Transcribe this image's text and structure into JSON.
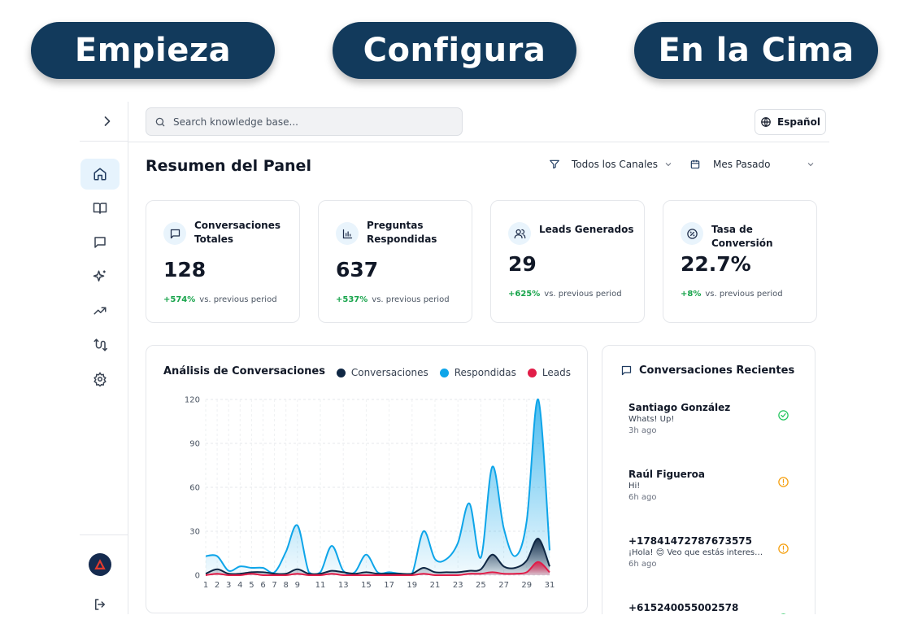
{
  "pills": [
    "Empieza",
    "Configura",
    "En la Cima"
  ],
  "search": {
    "placeholder": "Search knowledge base..."
  },
  "language": "Español",
  "page_title": "Resumen del Panel",
  "filters": {
    "channel": "Todos los Canales",
    "period": "Mes Pasado"
  },
  "nav": [
    "home-icon",
    "book-icon",
    "message-icon",
    "sparkles-icon",
    "trending-up-icon",
    "route-icon",
    "settings-icon"
  ],
  "stats": [
    {
      "label": "Conversaciones Totales",
      "value": "128",
      "delta": "+574%",
      "suffix": "vs. previous period",
      "icon": "message-icon"
    },
    {
      "label": "Preguntas Respondidas",
      "value": "637",
      "delta": "+537%",
      "suffix": "vs. previous period",
      "icon": "bar-chart-icon"
    },
    {
      "label": "Leads Generados",
      "value": "29",
      "delta": "+625%",
      "suffix": "vs. previous period",
      "icon": "users-icon"
    },
    {
      "label": "Tasa de Conversión",
      "value": "22.7%",
      "delta": "+8%",
      "suffix": "vs. previous period",
      "icon": "percent-icon"
    }
  ],
  "chart_title": "Análisis de Conversaciones",
  "chart_data": {
    "type": "area",
    "title": "Análisis de Conversaciones",
    "x": [
      1,
      2,
      3,
      4,
      5,
      6,
      7,
      8,
      9,
      10,
      11,
      12,
      13,
      14,
      15,
      16,
      17,
      18,
      19,
      20,
      21,
      22,
      23,
      24,
      25,
      26,
      27,
      28,
      29,
      30,
      31
    ],
    "xticks": [
      1,
      2,
      3,
      4,
      5,
      6,
      7,
      8,
      9,
      11,
      13,
      15,
      17,
      19,
      21,
      23,
      25,
      27,
      29,
      31
    ],
    "ylim": [
      0,
      120
    ],
    "yticks": [
      0,
      30,
      60,
      90,
      120
    ],
    "grid": true,
    "legend": "top-right",
    "series": [
      {
        "name": "Respondidas",
        "color": "#0ea5e9",
        "values": [
          13,
          13,
          3,
          6,
          5,
          5,
          2,
          16,
          34,
          2,
          2,
          20,
          3,
          2,
          14,
          2,
          2,
          1,
          1,
          30,
          11,
          11,
          22,
          49,
          12,
          74,
          32,
          13,
          37,
          120,
          17
        ]
      },
      {
        "name": "Conversaciones",
        "color": "#0f2744",
        "values": [
          1,
          4,
          1,
          1,
          2,
          2,
          1,
          1,
          4,
          1,
          1,
          3,
          2,
          1,
          2,
          1,
          1,
          1,
          1,
          5,
          2,
          2,
          2,
          3,
          4,
          14,
          6,
          5,
          10,
          25,
          6
        ]
      },
      {
        "name": "Leads",
        "color": "#e11d48",
        "values": [
          0,
          1,
          0,
          0,
          1,
          0,
          0,
          0,
          1,
          0,
          0,
          1,
          0,
          0,
          0,
          0,
          0,
          0,
          0,
          1,
          0,
          0,
          0,
          1,
          1,
          2,
          1,
          1,
          2,
          9,
          2
        ]
      }
    ]
  },
  "legend": [
    "Conversaciones",
    "Respondidas",
    "Leads"
  ],
  "recent_title": "Conversaciones Recientes",
  "recent": [
    {
      "name": "Santiago González",
      "message": "Whats! Up!",
      "time": "3h ago",
      "status": "resolved"
    },
    {
      "name": "Raúl Figueroa",
      "message": "Hi!",
      "time": "6h ago",
      "status": "pending"
    },
    {
      "name": "+17841472787673575",
      "message": "¡Hola! 😊 Veo que estás interesa...",
      "time": "6h ago",
      "status": "pending"
    },
    {
      "name": "+615240055002578",
      "message": "",
      "time": "",
      "status": "resolved"
    }
  ],
  "colors": {
    "brand": "#123a5c",
    "accent": "#0ea5e9",
    "success": "#16a34a",
    "warning": "#f59e0b"
  }
}
